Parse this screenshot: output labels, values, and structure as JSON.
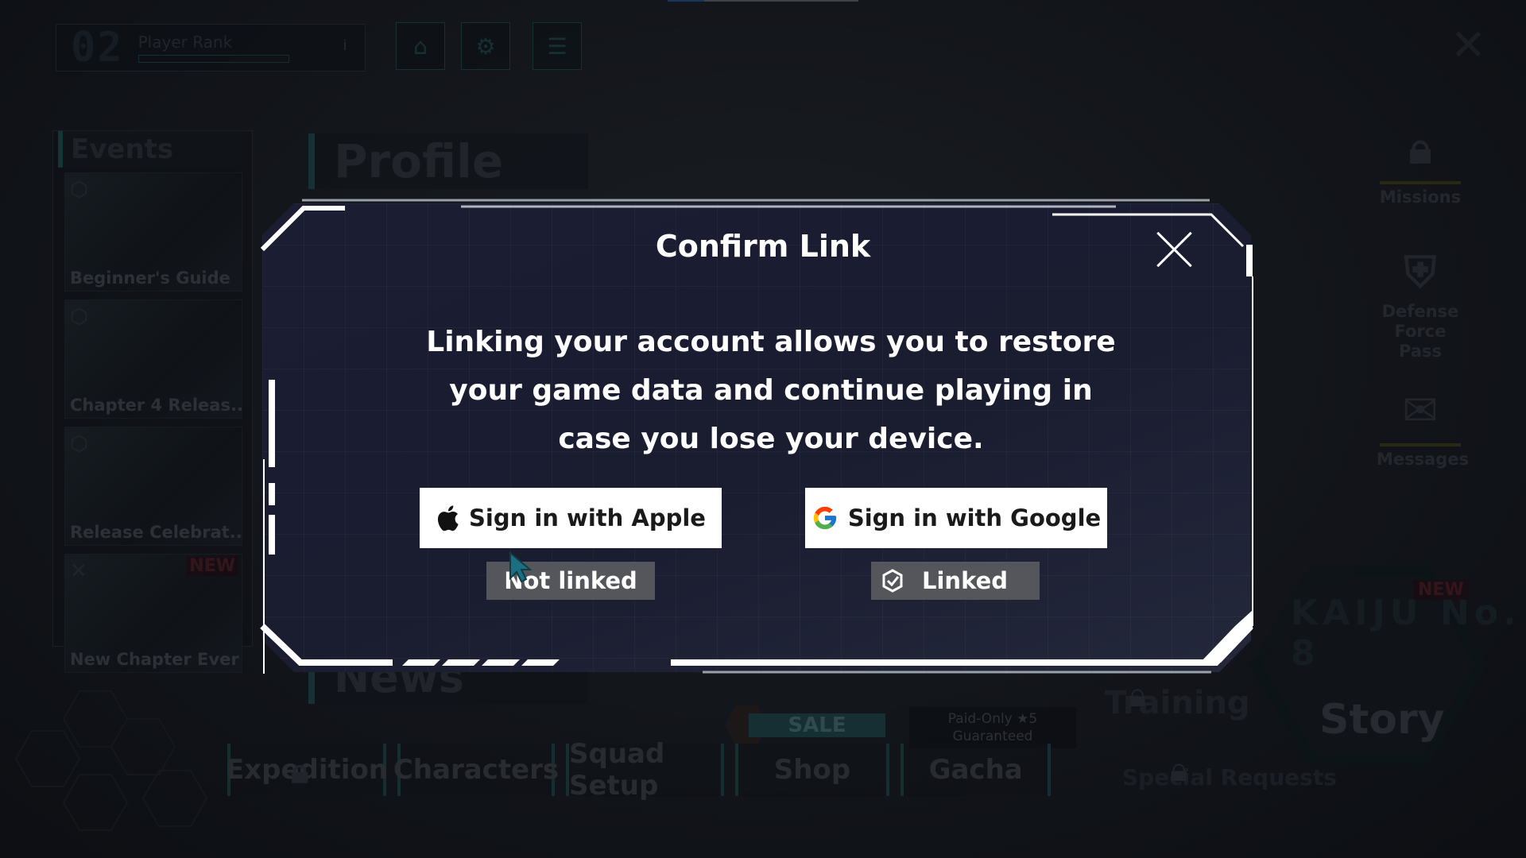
{
  "hud": {
    "rank_number": "02",
    "rank_label": "Player Rank",
    "info_icon": "info-icon",
    "top_icons": [
      "home-icon",
      "gear-icon",
      "menu-icon"
    ]
  },
  "events": {
    "title": "Events",
    "items": [
      {
        "label": "Beginner's Guide",
        "badge": ""
      },
      {
        "label": "Chapter 4 Releas...",
        "badge": ""
      },
      {
        "label": "Release Celebrat...",
        "badge": ""
      },
      {
        "label": "New Chapter Ever",
        "badge": "NEW"
      }
    ]
  },
  "tabs": {
    "profile": "Profile",
    "news": "News"
  },
  "side_menu": {
    "missions": "Missions",
    "defense_pass": "Defense Force Pass",
    "messages": "Messages"
  },
  "story": {
    "logo": "KAIJU No. 8",
    "label": "Story",
    "badge": "NEW"
  },
  "training": {
    "label": "Training"
  },
  "special": {
    "label": "Special Requests"
  },
  "bottom_nav": [
    {
      "label": "Expedition",
      "locked": true
    },
    {
      "label": "Characters",
      "locked": false
    },
    {
      "label": "Squad Setup",
      "locked": false
    },
    {
      "label": "Shop",
      "locked": false
    },
    {
      "label": "Gacha",
      "locked": false
    }
  ],
  "shop_promo": {
    "sale": "SALE",
    "paid_only": "Paid-Only ★5",
    "guaranteed": "Guaranteed"
  },
  "modal": {
    "title": "Confirm Link",
    "message": "Linking your account allows you to restore your game data and continue playing in case you lose your device.",
    "apple": {
      "label": "Sign in with Apple",
      "status": "Not linked"
    },
    "google": {
      "label": "Sign in with Google",
      "status": "Linked"
    }
  },
  "colors": {
    "modal_bg": "#1b1d33",
    "status_pill": "#54565c",
    "accent_teal": "#2e7070",
    "button_bg": "#ffffff"
  }
}
